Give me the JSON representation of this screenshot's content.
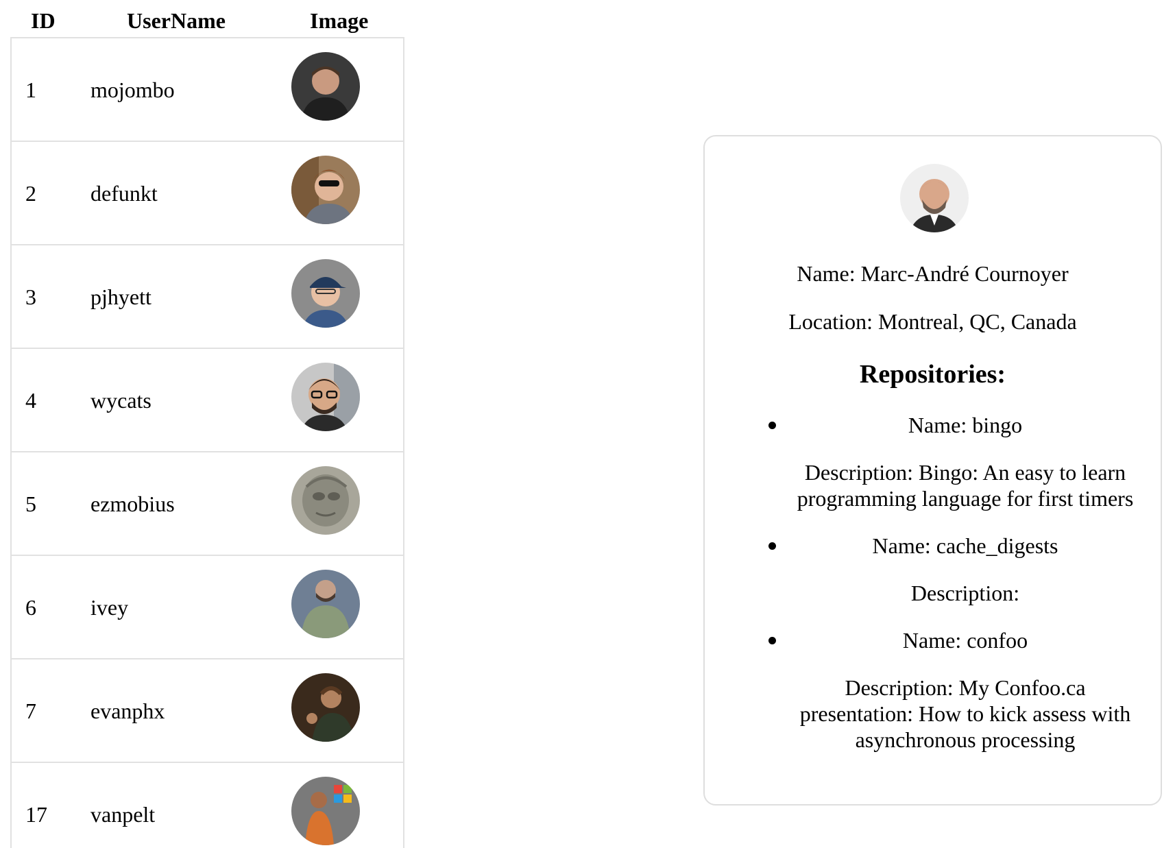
{
  "table": {
    "headers": {
      "id": "ID",
      "username": "UserName",
      "image": "Image"
    },
    "rows": [
      {
        "id": "1",
        "username": "mojombo",
        "avatar": "mojombo-avatar"
      },
      {
        "id": "2",
        "username": "defunkt",
        "avatar": "defunkt-avatar"
      },
      {
        "id": "3",
        "username": "pjhyett",
        "avatar": "pjhyett-avatar"
      },
      {
        "id": "4",
        "username": "wycats",
        "avatar": "wycats-avatar"
      },
      {
        "id": "5",
        "username": "ezmobius",
        "avatar": "ezmobius-avatar"
      },
      {
        "id": "6",
        "username": "ivey",
        "avatar": "ivey-avatar"
      },
      {
        "id": "7",
        "username": "evanphx",
        "avatar": "evanphx-avatar"
      },
      {
        "id": "17",
        "username": "vanpelt",
        "avatar": "vanpelt-avatar"
      }
    ]
  },
  "detail": {
    "name": "Name: Marc-André Cournoyer",
    "location": "Location: Montreal, QC, Canada",
    "repos_heading": "Repositories:",
    "repositories": [
      {
        "name": "Name: bingo",
        "description": "Description: Bingo: An easy to learn programming language for first timers"
      },
      {
        "name": "Name: cache_digests",
        "description": "Description:"
      },
      {
        "name": "Name: confoo",
        "description": "Description: My Confoo.ca presentation: How to kick assess with asynchronous processing"
      }
    ]
  }
}
